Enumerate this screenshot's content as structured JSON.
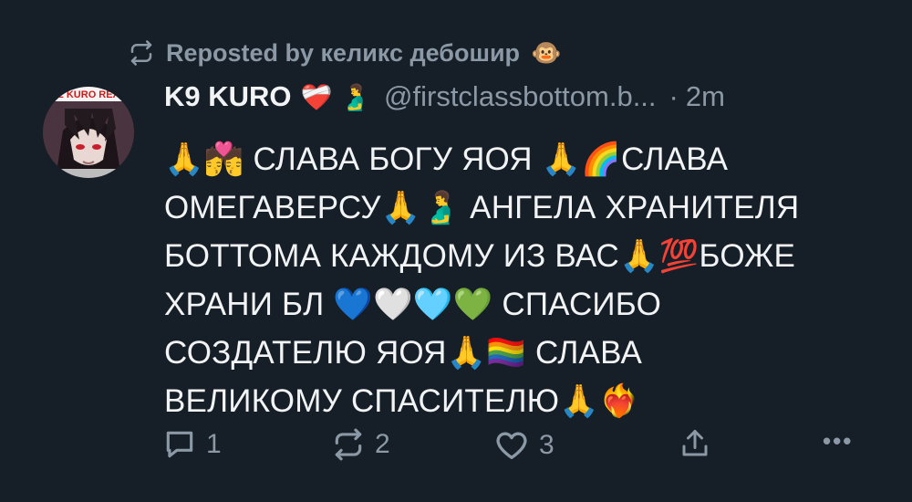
{
  "repost": {
    "label": "Reposted by келикс дебошир",
    "emoji": "🐵",
    "icon": "repost-icon"
  },
  "post": {
    "avatar_text": "E KURO REA",
    "author_name": "K9 KURO",
    "name_emojis": "❤️‍🩹 🫃",
    "handle": "@firstclassbottom.b...",
    "separator": "·",
    "time": "2m",
    "lines": [
      "🙏💏 СЛАВА БОГУ ЯОЯ 🙏🌈СЛАВА",
      "ОМЕГАВЕРСУ🙏🫃 АНГЕЛА ХРАНИТЕЛЯ",
      "БОТТОМА КАЖДОМУ ИЗ ВАС🙏💯БОЖЕ",
      "ХРАНИ БЛ 💙🤍🩵💚 СПАСИБО",
      "СОЗДАТЕЛЮ ЯОЯ🙏🏳️‍🌈 СЛАВА",
      "ВЕЛИКОМУ СПАСИТЕЛЮ🙏❤️‍🔥"
    ]
  },
  "actions": {
    "reply": {
      "icon": "reply-icon",
      "count": "1"
    },
    "repost": {
      "icon": "repost-icon",
      "count": "2"
    },
    "like": {
      "icon": "heart-icon",
      "count": "3"
    },
    "share": {
      "icon": "share-icon"
    },
    "more": {
      "icon": "more-icon",
      "label": "•••"
    }
  },
  "colors": {
    "background": "#161e27",
    "text": "#f1f3f5",
    "muted": "#8b98a5"
  }
}
